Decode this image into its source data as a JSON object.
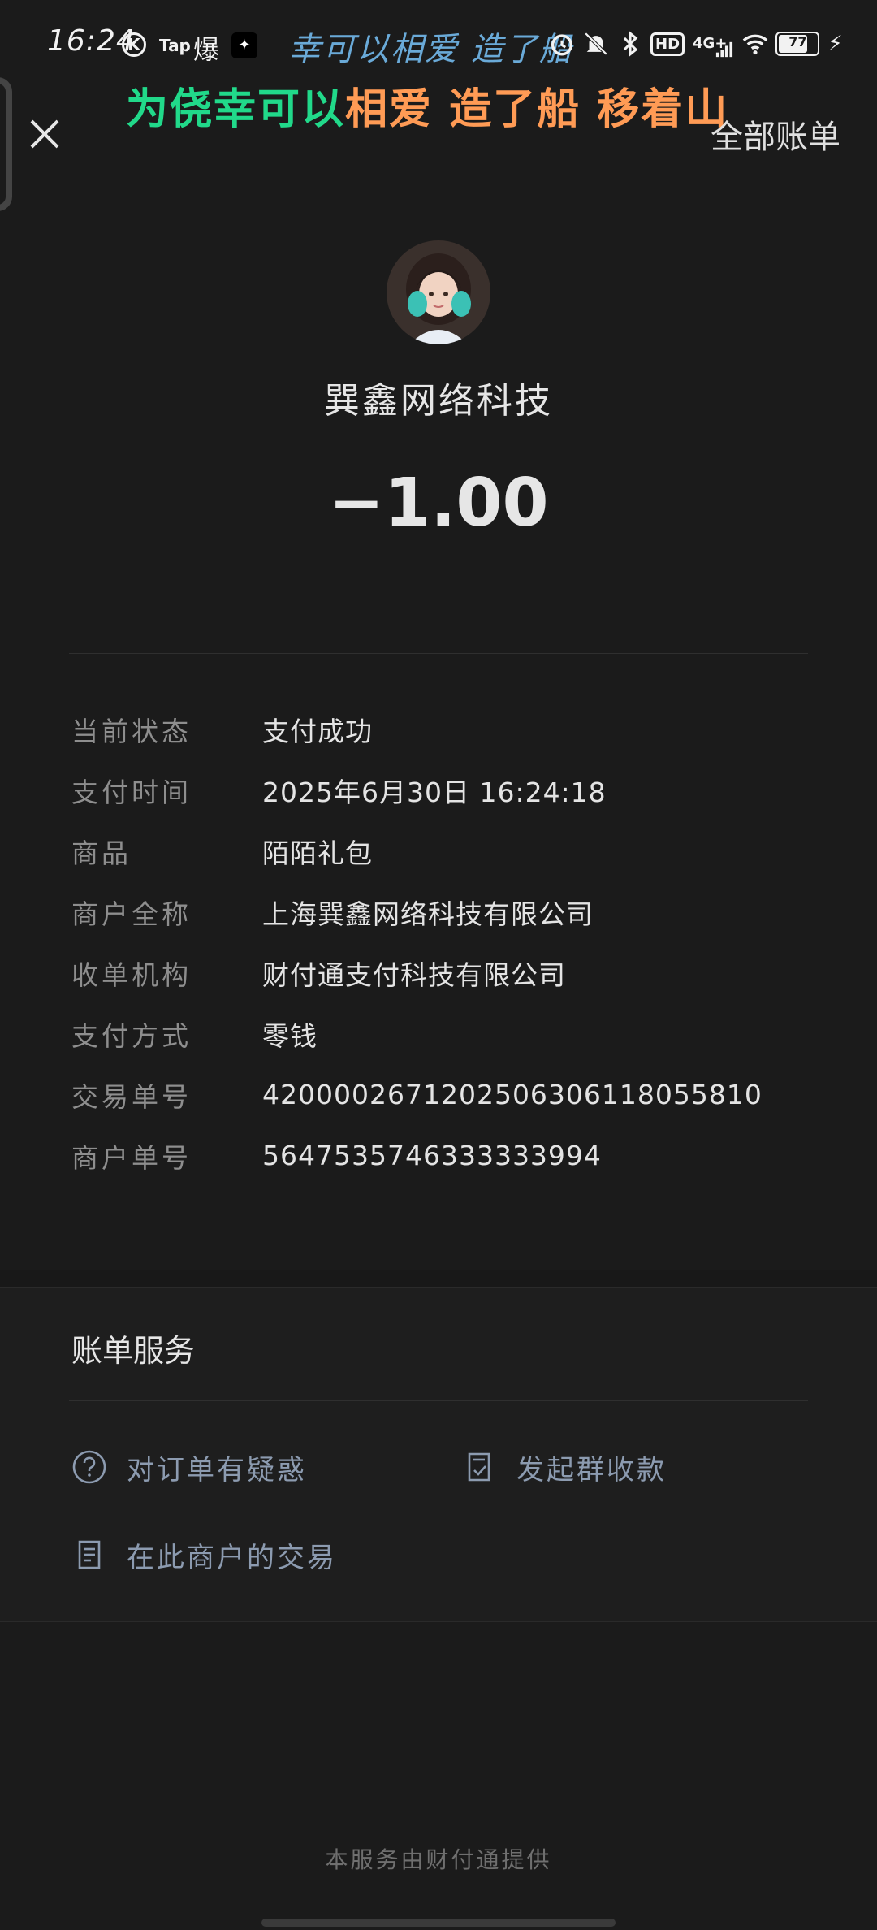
{
  "status_bar": {
    "time": "16:24",
    "k_badge": "K",
    "tap_label": "Tap",
    "bao_label": "爆",
    "marquee_text": "幸可以相爱 造了船",
    "hd_label": "HD",
    "network_label": "4G+",
    "battery_level": "77"
  },
  "overlay_banner": {
    "part_green": "为侥幸可以",
    "part_orange": "相爱 造了船 移着山"
  },
  "nav": {
    "close_icon": "close-icon",
    "all_bills": "全部账单"
  },
  "header": {
    "merchant_name": "巽鑫网络科技",
    "amount": "−1.00"
  },
  "details": [
    {
      "label": "当前状态",
      "value": "支付成功"
    },
    {
      "label": "支付时间",
      "value": "2025年6月30日 16:24:18"
    },
    {
      "label": "商品",
      "value": "陌陌礼包"
    },
    {
      "label": "商户全称",
      "value": "上海巽鑫网络科技有限公司"
    },
    {
      "label": "收单机构",
      "value": "财付通支付科技有限公司"
    },
    {
      "label": "支付方式",
      "value": "零钱"
    },
    {
      "label": "交易单号",
      "value": "4200002671202506306118055810"
    },
    {
      "label": "商户单号",
      "value": "5647535746333333994"
    }
  ],
  "services": {
    "title": "账单服务",
    "items": [
      {
        "label": "对订单有疑惑",
        "icon": "question-circle-icon"
      },
      {
        "label": "发起群收款",
        "icon": "group-receipt-icon"
      },
      {
        "label": "在此商户的交易",
        "icon": "document-icon"
      }
    ]
  },
  "footer": "本服务由财付通提供",
  "colors": {
    "background": "#1b1b1b",
    "banner_green": "#21d98a",
    "banner_orange": "#ff9b55",
    "service_link": "#8c9bb0"
  }
}
